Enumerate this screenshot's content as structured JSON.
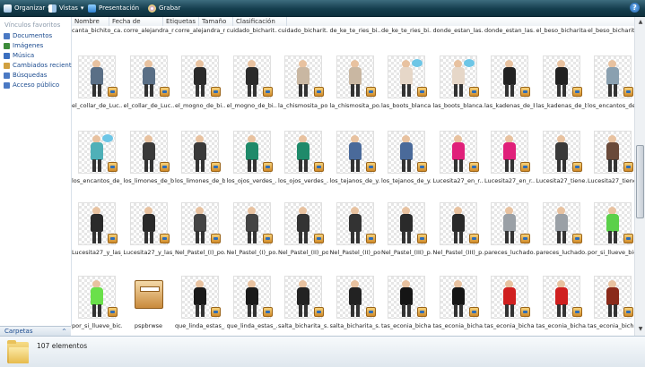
{
  "toolbar": {
    "organize": "Organizar",
    "views": "Vistas",
    "slideshow": "Presentación",
    "burn": "Grabar",
    "help": "?"
  },
  "nav": {
    "title": "Vínculos favoritos",
    "items": [
      {
        "label": "Documentos",
        "color": "#4a79c4"
      },
      {
        "label": "Imágenes",
        "color": "#3d8c3a"
      },
      {
        "label": "Música",
        "color": "#3b6fc0"
      },
      {
        "label": "Cambiados recientemente",
        "color": "#d0a040"
      },
      {
        "label": "Búsquedas",
        "color": "#4a79c4"
      },
      {
        "label": "Acceso público",
        "color": "#4a79c4"
      }
    ],
    "folders_label": "Carpetas",
    "folders_chevron": "^"
  },
  "columns": [
    "Nombre",
    "Fecha de captura",
    "Etiquetas",
    "Tamaño",
    "Clasificación"
  ],
  "top_row_labels": [
    "canta_bichito_ca...",
    "corre_alejandra_r...",
    "corre_alejandra_r...",
    "cuidado_bicharit...",
    "cuidado_bicharit...",
    "de_ke_te_ries_bi...",
    "de_ke_te_ries_bi...",
    "donde_estan_las...",
    "donde_estan_las...",
    "el_beso_bicharita...",
    "el_beso_bicharita..."
  ],
  "rows": [
    [
      "el_collar_de_Luc...",
      "el_collar_de_Luc...",
      "el_mogno_de_bi...",
      "el_mogno_de_bi...",
      "la_chismosita_po...",
      "la_chismosita_po...",
      "las_boots_blanca...",
      "las_boots_blanca...",
      "las_kadenas_de_b...",
      "las_kadenas_de_b...",
      "los_encantos_de..."
    ],
    [
      "los_encantos_de_...",
      "los_limones_de_b...",
      "los_limones_de_b...",
      "los_ojos_verdes_...",
      "los_ojos_verdes_...",
      "los_tejanos_de_y...",
      "los_tejanos_de_y...",
      "Lucesita27_en_r...",
      "Lucesita27_en_r...",
      "Lucesita27_tiene...",
      "Lucesita27_tiene..."
    ],
    [
      "Lucesita27_y_las_...",
      "Lucesita27_y_las_...",
      "Nel_Pastel_(I)_po...",
      "Nel_Pastel_(I)_po...",
      "Nel_Pastel_(II)_po...",
      "Nel_Pastel_(II)_po...",
      "Nel_Pastel_(III)_p...",
      "Nel_Pastel_(III)_p...",
      "pareces_luchado...",
      "pareces_luchado...",
      "por_si_llueve_bic..."
    ],
    [
      "por_si_llueve_bic...",
      "pspbrwse",
      "que_linda_estas_...",
      "que_linda_estas_...",
      "salta_bicharita_s...",
      "salta_bicharita_s...",
      "tas_econia_bicha...",
      "tas_econia_bicha...",
      "tas_econia_bicha...",
      "tas_econia_bicha...",
      "tas_econia_bicha..."
    ]
  ],
  "thumb_colors": [
    [
      "#5a6f86",
      "#5a6f86",
      "#2b2b2b",
      "#2b2b2b",
      "#c9b7a2",
      "#c9b7a2",
      "#e6d7c8",
      "#e6d7c8",
      "#222222",
      "#222222",
      "#8aa0b0"
    ],
    [
      "#4fb0b8",
      "#3a3a3a",
      "#3a3a3a",
      "#1f8a6a",
      "#1f8a6a",
      "#4a6a9a",
      "#4a6a9a",
      "#e0207a",
      "#e0207a",
      "#3a3a3a",
      "#6a4a3a"
    ],
    [
      "#2a2a2a",
      "#2a2a2a",
      "#444444",
      "#444444",
      "#333333",
      "#333333",
      "#2a2a2a",
      "#2a2a2a",
      "#9aa0a6",
      "#9aa0a6",
      "#5ad04a"
    ],
    [
      "#6ae04a",
      "folder",
      "#1a1a1a",
      "#1a1a1a",
      "#222222",
      "#222222",
      "#151515",
      "#151515",
      "#d02020",
      "#d02020",
      "#8a2a1a"
    ]
  ],
  "status": {
    "count": "107 elementos"
  }
}
